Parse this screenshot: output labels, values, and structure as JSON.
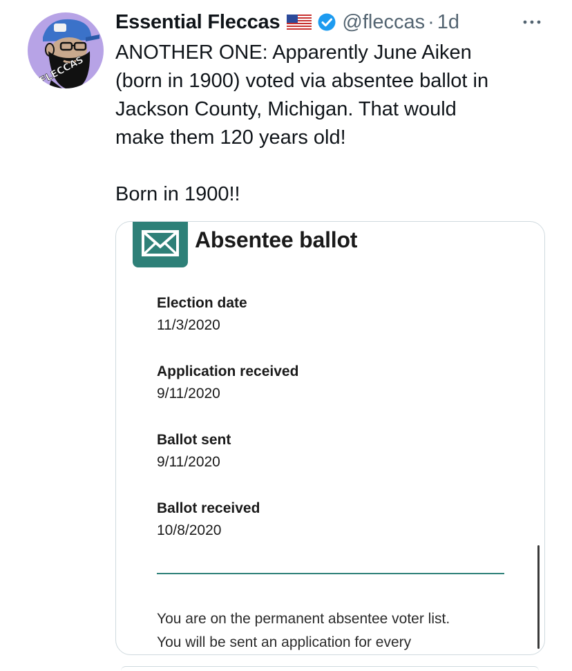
{
  "author": {
    "display_name": "Essential Fleccas",
    "handle": "@fleccas",
    "separator": "·",
    "time": "1d",
    "avatar_text": "FLECCAS",
    "flag_icon": "us-flag-icon",
    "verified_icon": "verified-badge-icon"
  },
  "tweet": {
    "text_lines": [
      "ANOTHER ONE: Apparently June Aiken",
      "(born in 1900) voted via absentee ballot in",
      "Jackson County, Michigan. That would",
      "make them 120 years old!"
    ],
    "text_second": "Born in 1900!!"
  },
  "media": {
    "title": "Absentee ballot",
    "icon": "mail-envelope-icon",
    "fields": [
      {
        "label": "Election date",
        "value": "11/3/2020"
      },
      {
        "label": "Application received",
        "value": "9/11/2020"
      },
      {
        "label": "Ballot sent",
        "value": "9/11/2020"
      },
      {
        "label": "Ballot received",
        "value": "10/8/2020"
      }
    ],
    "notice_lines": [
      "You are on the permanent absentee voter list.",
      "You will be sent an application for every"
    ]
  },
  "colors": {
    "text": "#0f1419",
    "secondary": "#536471",
    "verified": "#1d9bf0",
    "accent_teal": "#2e8078",
    "avatar_bg": "#b7a3e6"
  }
}
